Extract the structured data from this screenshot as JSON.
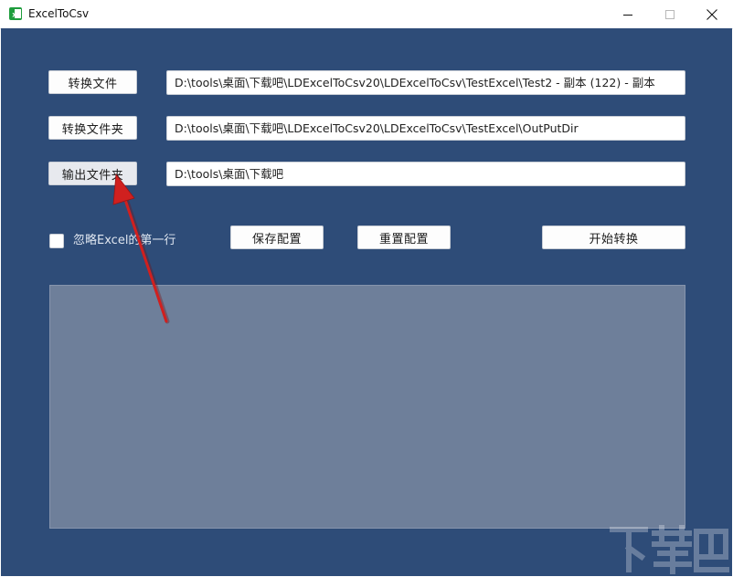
{
  "window": {
    "title": "ExcelToCsv",
    "controls": {
      "minimize_icon": "minimize-icon",
      "maximize_icon": "maximize-icon",
      "close_icon": "close-icon"
    }
  },
  "rows": [
    {
      "button_label": "转换文件",
      "path": "D:\\tools\\桌面\\下载吧\\LDExcelToCsv20\\LDExcelToCsv\\TestExcel\\Test2 - 副本 (122) - 副本"
    },
    {
      "button_label": "转换文件夹",
      "path": "D:\\tools\\桌面\\下载吧\\LDExcelToCsv20\\LDExcelToCsv\\TestExcel\\OutPutDir"
    },
    {
      "button_label": "输出文件夹",
      "path": "D:\\tools\\桌面\\下载吧"
    }
  ],
  "options": {
    "ignore_first_row_label": "忽略Excel的第一行",
    "ignore_first_row_checked": false
  },
  "actions": {
    "save_config": "保存配置",
    "reset_config": "重置配置",
    "start_convert": "开始转换"
  },
  "output_log": "",
  "colors": {
    "client_bg": "#2e4c78",
    "output_bg": "#6e7f9a",
    "annotation_arrow": "#d0201f"
  }
}
